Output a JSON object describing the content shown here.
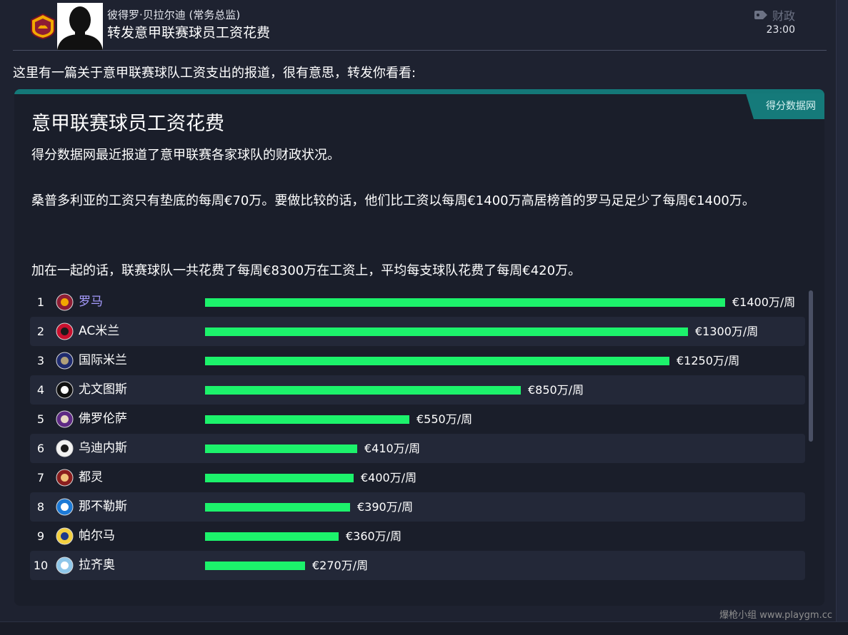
{
  "header": {
    "sender": "彼得罗·贝拉尔迪 (常务总监)",
    "subject": "转发意甲联赛球员工资花费",
    "tag": "财政",
    "time": "23:00"
  },
  "intro": "这里有一篇关于意甲联赛球队工资支出的报道，很有意思，转发你看看:",
  "article": {
    "source": "得分数据网",
    "title": "意甲联赛球员工资花费",
    "paragraphs": [
      "得分数据网最近报道了意甲联赛各家球队的财政状况。",
      "桑普多利亚的工资只有垫底的每周€70万。要做比较的话，他们比工资以每周€1400万高居榜首的罗马足足少了每周€1400万。",
      "加在一起的话，联赛球队一共花费了每周€8300万在工资上，平均每支球队花费了每周€420万。"
    ]
  },
  "wage_table": {
    "max_value": 1400,
    "rows": [
      {
        "rank": "1",
        "team": "罗马",
        "value": 1400,
        "label": "€1400万/周",
        "badge": "roma",
        "c1": "#8d1d34",
        "c2": "#f2a900",
        "highlight": true
      },
      {
        "rank": "2",
        "team": "AC米兰",
        "value": 1300,
        "label": "€1300万/周",
        "badge": "milan",
        "c1": "#c8102e",
        "c2": "#1a1a1a"
      },
      {
        "rank": "3",
        "team": "国际米兰",
        "value": 1250,
        "label": "€1250万/周",
        "badge": "inter",
        "c1": "#1f2b6e",
        "c2": "#b0a07a"
      },
      {
        "rank": "4",
        "team": "尤文图斯",
        "value": 850,
        "label": "€850万/周",
        "badge": "juve",
        "c1": "#111111",
        "c2": "#ffffff"
      },
      {
        "rank": "5",
        "team": "佛罗伦萨",
        "value": 550,
        "label": "€550万/周",
        "badge": "fiorentina",
        "c1": "#5e2a84",
        "c2": "#e8d9c4"
      },
      {
        "rank": "6",
        "team": "乌迪内斯",
        "value": 410,
        "label": "€410万/周",
        "badge": "udinese",
        "c1": "#f2f2f2",
        "c2": "#1a1a1a"
      },
      {
        "rank": "7",
        "team": "都灵",
        "value": 400,
        "label": "€400万/周",
        "badge": "torino",
        "c1": "#8a1e1e",
        "c2": "#f0c27a"
      },
      {
        "rank": "8",
        "team": "那不勒斯",
        "value": 390,
        "label": "€390万/周",
        "badge": "napoli",
        "c1": "#1d7ad6",
        "c2": "#ffffff"
      },
      {
        "rank": "9",
        "team": "帕尔马",
        "value": 360,
        "label": "€360万/周",
        "badge": "parma",
        "c1": "#f4d03f",
        "c2": "#1f3a8a"
      },
      {
        "rank": "10",
        "team": "拉齐奥",
        "value": 270,
        "label": "€270万/周",
        "badge": "lazio",
        "c1": "#8fc7ea",
        "c2": "#ffffff"
      }
    ]
  },
  "watermark": "爆枪小组 www.playgm.cc"
}
